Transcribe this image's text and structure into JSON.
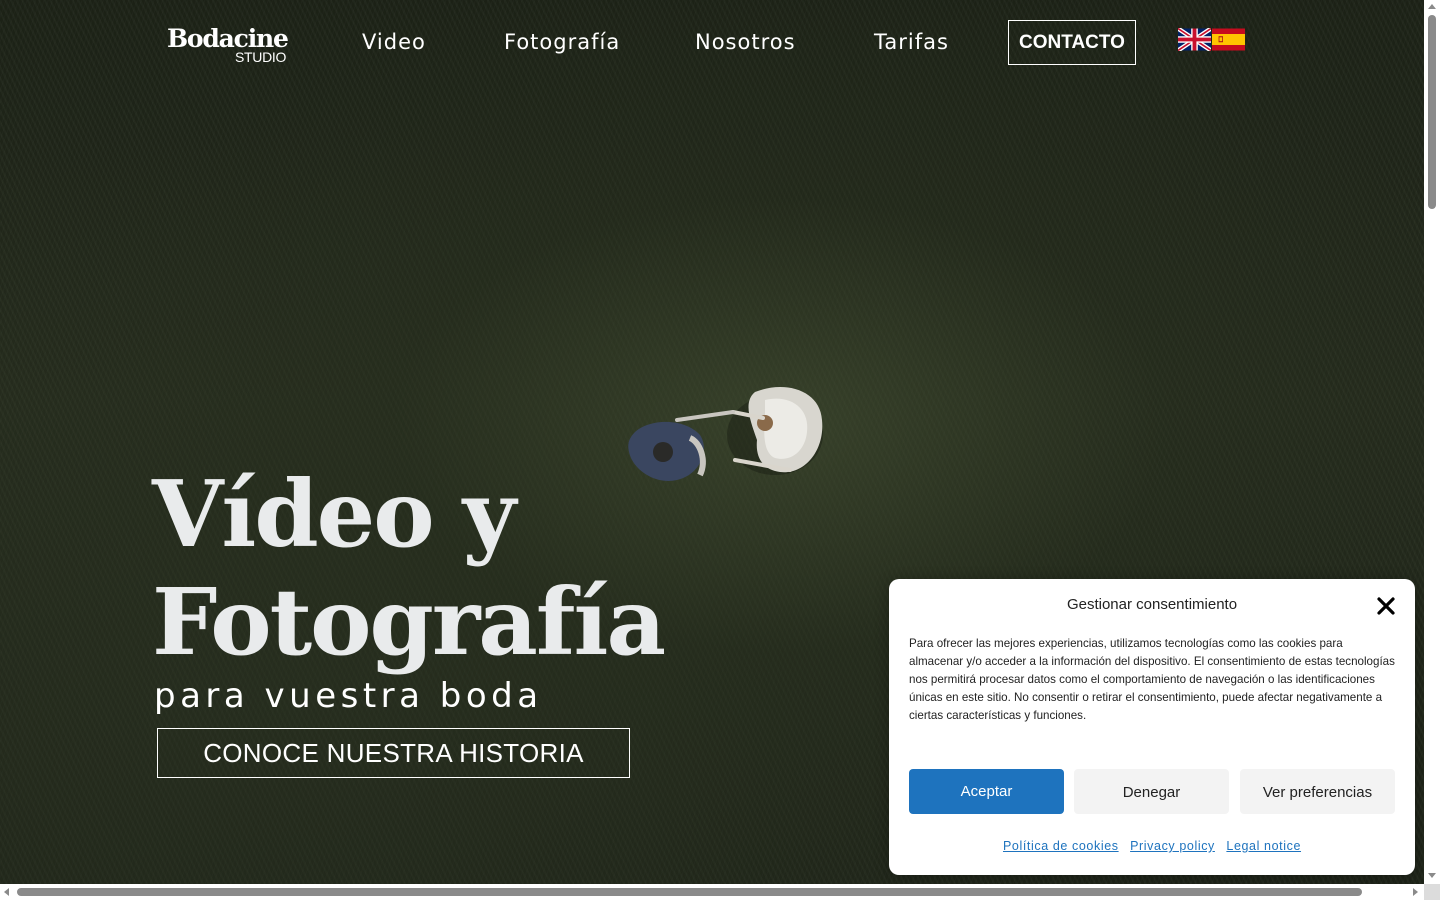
{
  "nav": {
    "logo": {
      "line1": "Bodacine",
      "line2": "STUDIO"
    },
    "links": [
      {
        "label": "Video"
      },
      {
        "label": "Fotografía"
      },
      {
        "label": "Nosotros"
      },
      {
        "label": "Tarifas"
      }
    ],
    "contact_label": "CONTACTO",
    "flags": [
      "uk-flag-icon",
      "spain-flag-icon"
    ]
  },
  "hero": {
    "title_line1": "Vídeo y",
    "title_line2": "Fotografía",
    "subtitle": "para vuestra boda",
    "cta_label": "CONOCE NUESTRA HISTORIA"
  },
  "cookie": {
    "title": "Gestionar consentimiento",
    "body": "Para ofrecer las mejores experiencias, utilizamos tecnologías como las cookies para almacenar y/o acceder a la información del dispositivo. El consentimiento de estas tecnologías nos permitirá procesar datos como el comportamiento de navegación o las identificaciones únicas en este sitio. No consentir o retirar el consentimiento, puede afectar negativamente a ciertas características y funciones.",
    "accept_label": "Aceptar",
    "deny_label": "Denegar",
    "prefs_label": "Ver preferencias",
    "links": [
      {
        "label": "Política de cookies"
      },
      {
        "label": "Privacy policy"
      },
      {
        "label": "Legal notice"
      }
    ],
    "close_icon": "close-icon"
  },
  "colors": {
    "accent": "#1e73be",
    "hero_text": "#e9ebec",
    "modal_bg": "#ffffff",
    "button_neutral": "#f3f3f3"
  }
}
